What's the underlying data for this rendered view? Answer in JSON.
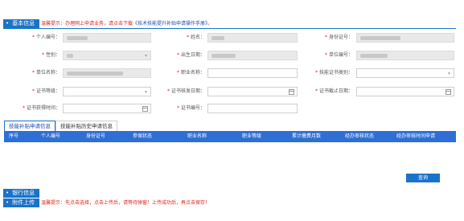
{
  "basic_info": {
    "tab_label": "基本信息",
    "notice_text": "温馨提示：办理网上申请业务，请点击下载",
    "notice_link": "《技术技能提升补贴申请操作手册》",
    "notice_end": "。"
  },
  "form": {
    "personal_id_label": "个人编号：",
    "name_label": "姓名：",
    "id_number_label": "身份证号：",
    "gender_label": "性别：",
    "birth_date_label": "出生日期：",
    "unit_id_label": "单位编号：",
    "unit_name_label": "单位名称：",
    "profession_label": "职业名称：",
    "skill_level_label": "技能证书类别：",
    "cert_level_label": "证书等级：",
    "cert_issue_date_label": "证书核发日期：",
    "cert_date2_label": "证书截止日期：",
    "cert_apply_date_label": "证书获得时间：",
    "cert_number_label": "证书编号："
  },
  "tabs": [
    {
      "label": "技能补贴申请信息"
    },
    {
      "label": "技能补贴历史申请信息"
    }
  ],
  "table": {
    "headers": [
      "序号",
      "个人编号",
      "身份证号",
      "参保状态",
      "职业名称",
      "职业等级",
      "累计缴费月数",
      "经办审核状态",
      "经办审核时间申请"
    ]
  },
  "query_button": "查询",
  "bank_info": {
    "tab_label": "银行信息"
  },
  "upload": {
    "tab_label": "附件上传",
    "notice_text": "温馨提示：先点击选择，点击上传后，请等待弹窗！上传成功后，再点击保存！"
  },
  "colors": {
    "accent": "#1a73c9",
    "table_header": "#2e6fd6",
    "warning": "#e2241a"
  }
}
